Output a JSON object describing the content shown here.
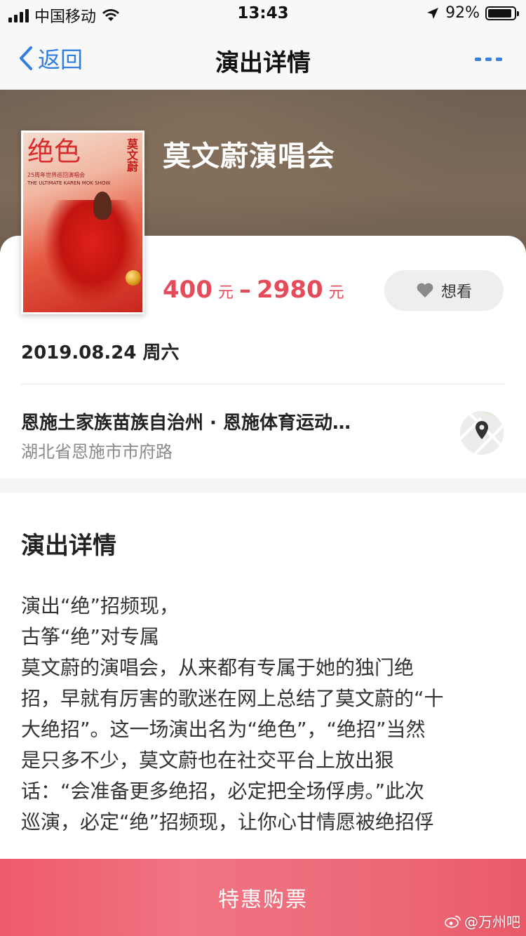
{
  "status_bar": {
    "carrier": "中国移动",
    "time": "13:43",
    "battery": "92%",
    "battery_level": 0.92
  },
  "nav": {
    "back_label": "返回",
    "title": "演出详情"
  },
  "event": {
    "title": "莫文蔚演唱会",
    "poster": {
      "title": "绝色",
      "artist": "莫文蔚",
      "line1": "25周年世界巡回演唱会",
      "line2": "THE ULTIMATE KAREN MOK SHOW"
    },
    "price_min": "400",
    "price_max": "2980",
    "price_unit": "元",
    "price_sep": "–",
    "want_label": "想看",
    "date": "2019.08.24 周六",
    "venue": "恩施土家族苗族自治州 · 恩施体育运动…",
    "address": "湖北省恩施市市府路"
  },
  "details": {
    "heading": "演出详情",
    "lines": [
      "演出“绝”招频现，",
      "古筝“绝”对专属",
      "莫文蔚的演唱会，从来都有专属于她的独门绝",
      "招，早就有厉害的歌迷在网上总结了莫文蔚的“十",
      "大绝招”。这一场演出名为“绝色”，“绝招”当然",
      "是只多不少，莫文蔚也在社交平台上放出狠",
      "话：“会准备更多绝招，必定把全场俘虏。”此次",
      "巡演，必定“绝”招频现，让你心甘情愿被绝招俘"
    ]
  },
  "buy_button": "特惠购票",
  "watermark": "@万州吧",
  "colors": {
    "accent_blue": "#2f7fe0",
    "price_red": "#e64b5a",
    "buy_button": "#ee6677"
  }
}
